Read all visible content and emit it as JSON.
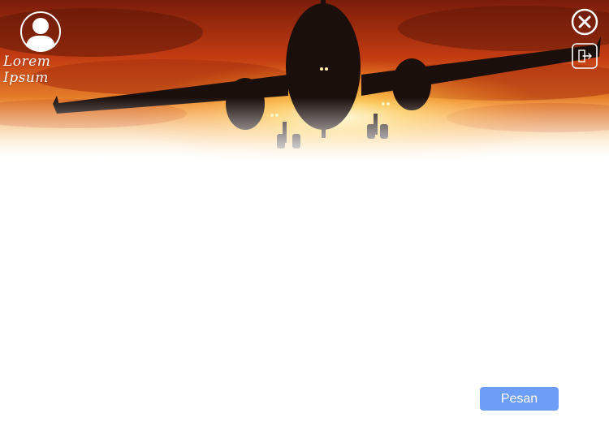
{
  "profile": {
    "name": "Lorem Ipsum",
    "avatar_icon": "user-silhouette-icon"
  },
  "header": {
    "close_icon": "close-circle-icon",
    "logout_icon": "logout-icon",
    "banner_image": "airplane-sunset-banner"
  },
  "actions": {
    "order_label": "Pesan"
  },
  "colors": {
    "primary_button": "#6d9ef7",
    "icon": "#ffffff",
    "sky_orange": "#e0631c"
  }
}
